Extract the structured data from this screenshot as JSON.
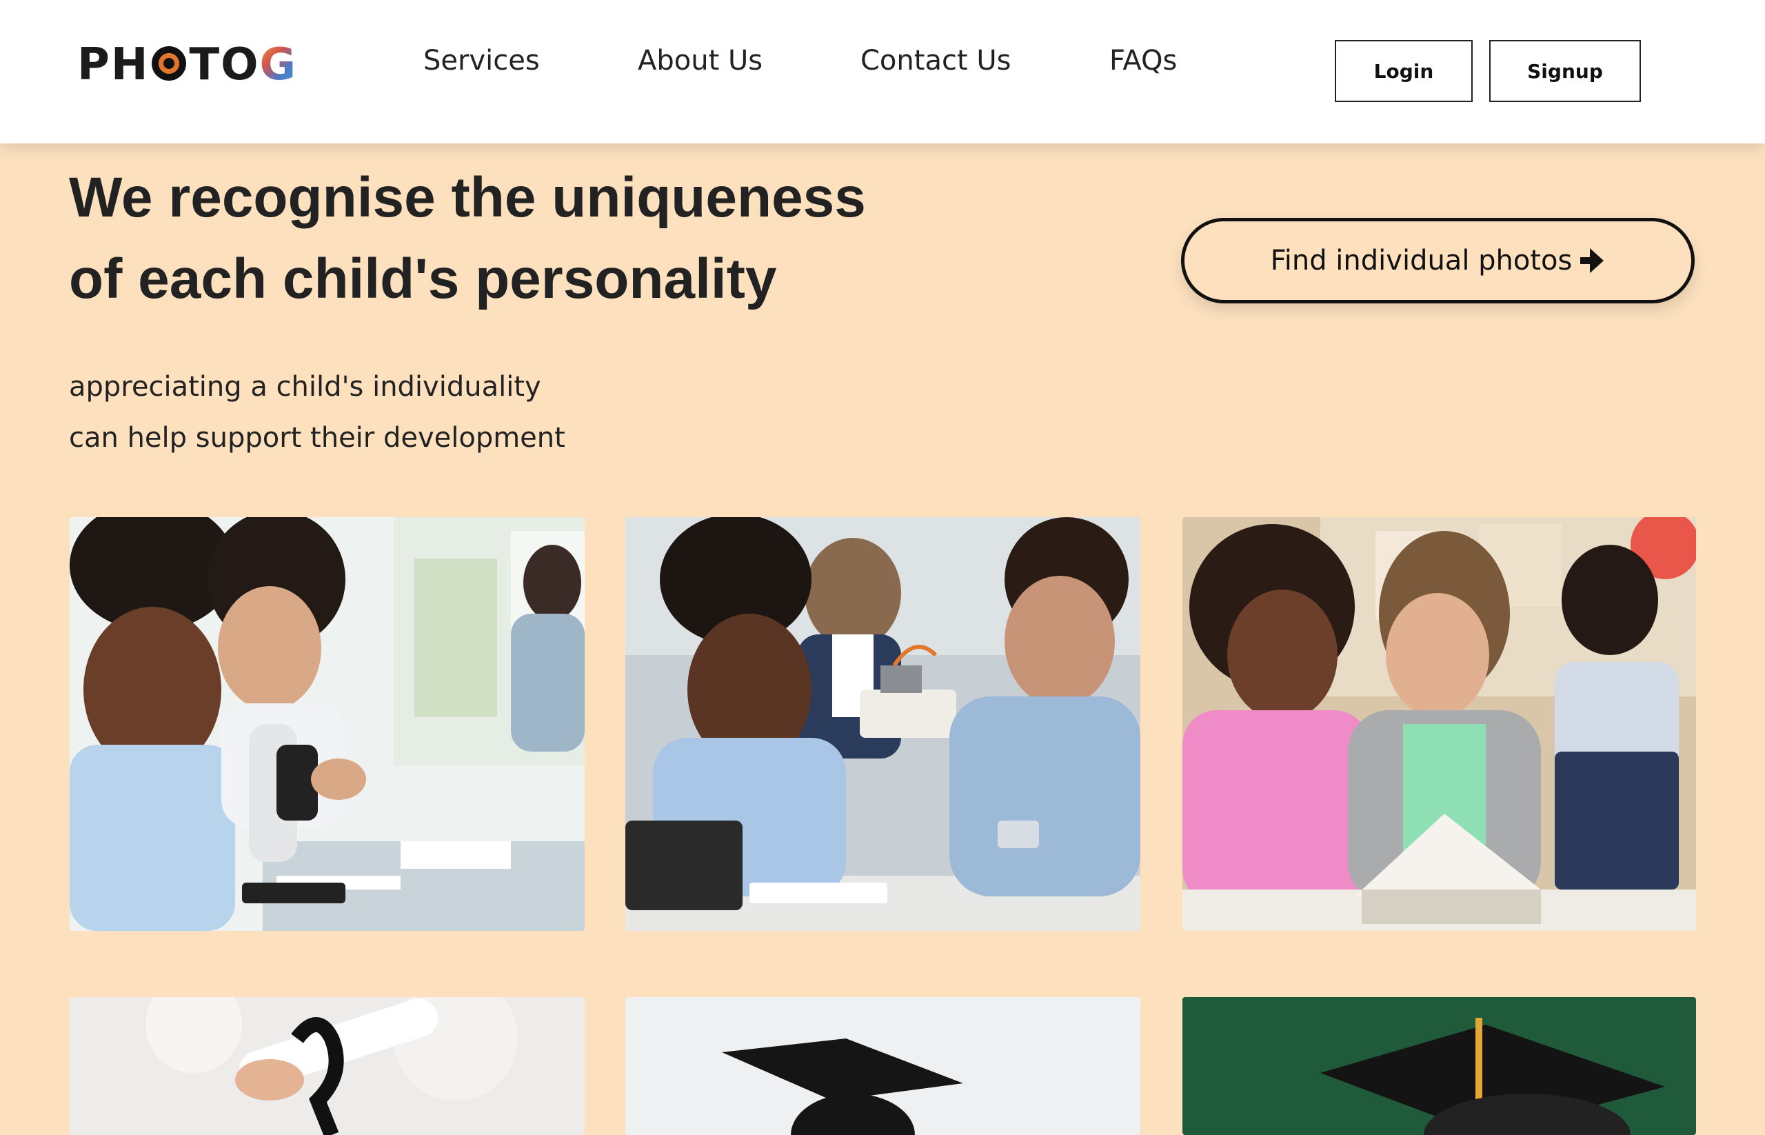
{
  "header": {
    "logo_text": "PHOTOG",
    "nav": [
      {
        "label": "Services"
      },
      {
        "label": "About Us"
      },
      {
        "label": "Contact Us"
      },
      {
        "label": "FAQs"
      }
    ],
    "login_label": "Login",
    "signup_label": "Signup"
  },
  "hero": {
    "title_line1": "We recognise the uniqueness",
    "title_line2": "of each child's personality",
    "subtitle_line1": "appreciating a child's individuality",
    "subtitle_line2": "can help support their development",
    "cta_label": "Find individual photos",
    "cta_icon": "arrow-right-icon"
  },
  "gallery": {
    "photos": [
      {
        "subject": "students-microscope-photo"
      },
      {
        "subject": "girl-robot-photo"
      },
      {
        "subject": "girls-reading-photo"
      },
      {
        "subject": "diploma-photo"
      },
      {
        "subject": "graduation-cap-photo"
      },
      {
        "subject": "graduate-chalkboard-photo"
      }
    ]
  },
  "colors": {
    "background": "#fde1bf",
    "header_bg": "#ffffff",
    "text": "#222222"
  }
}
